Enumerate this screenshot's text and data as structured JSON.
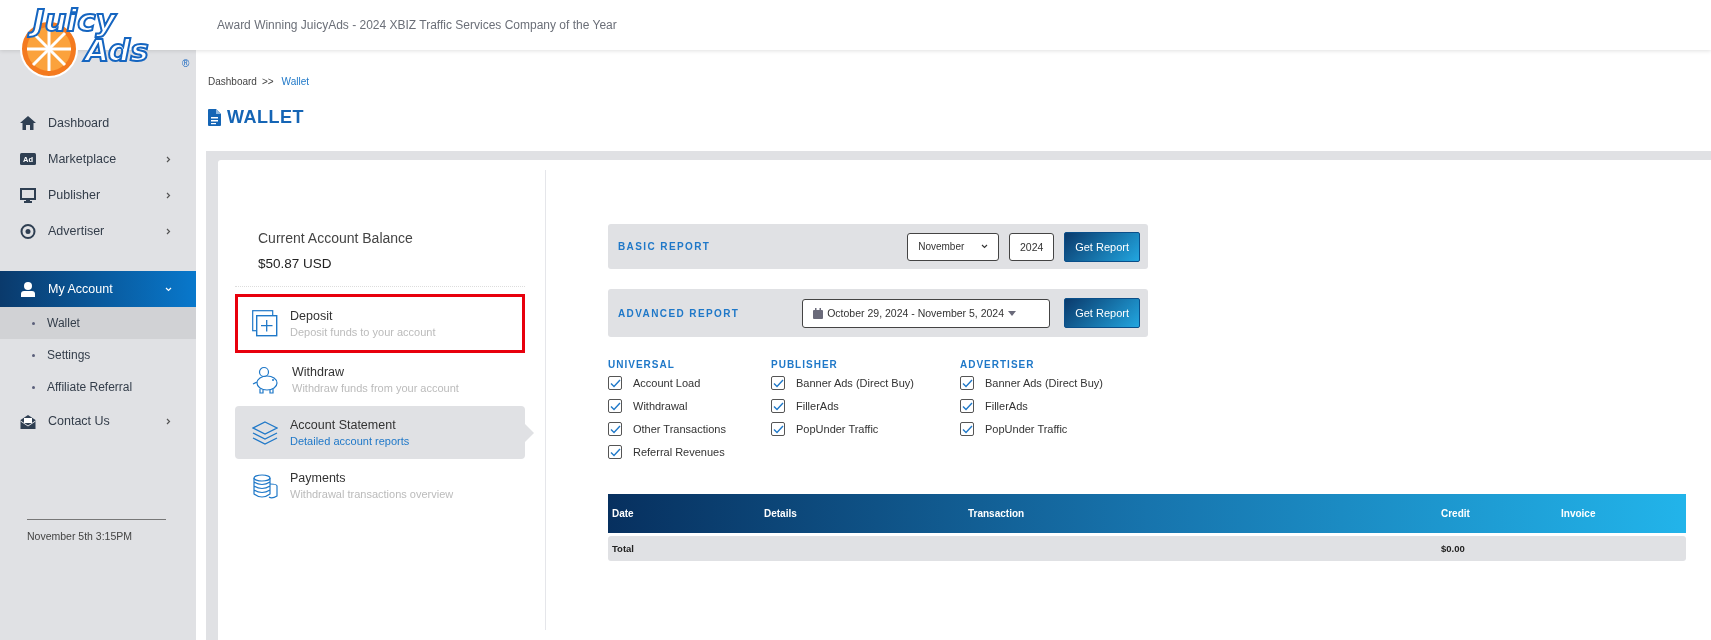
{
  "logo": {
    "line1": "Juicy",
    "line2": "Ads",
    "mark": "®"
  },
  "header": {
    "tagline": "Award Winning JuicyAds - 2024 XBIZ Traffic Services Company of the Year"
  },
  "sidebar": {
    "items": [
      {
        "kind": "home",
        "label": "Dashboard",
        "submenu": false,
        "expanded": false
      },
      {
        "kind": "ad",
        "label": "Marketplace",
        "icon_text": "Ad",
        "submenu": true,
        "expanded": false
      },
      {
        "kind": "monitor",
        "label": "Publisher",
        "submenu": true,
        "expanded": false
      },
      {
        "kind": "target",
        "label": "Advertiser",
        "submenu": true,
        "expanded": false
      },
      {
        "kind": "user",
        "label": "My Account",
        "submenu": true,
        "expanded": true,
        "children": [
          {
            "label": "Wallet",
            "selected": true
          },
          {
            "label": "Settings",
            "selected": false
          },
          {
            "label": "Affiliate Referral",
            "selected": false
          }
        ]
      },
      {
        "kind": "mail",
        "label": "Contact Us",
        "submenu": true,
        "expanded": false
      }
    ],
    "datetime": "November 5th 3:15PM"
  },
  "breadcrumb": [
    {
      "label": "Dashboard",
      "current": false
    },
    {
      "label": "Wallet",
      "current": true
    }
  ],
  "breadcrumb_separator": ">>",
  "page_title": "WALLET",
  "wallet": {
    "balance_label": "Current Account Balance",
    "balance": "$50.87 USD",
    "actions": [
      {
        "kind": "deposit",
        "title": "Deposit",
        "subtitle": "Deposit funds to your account",
        "selected": false,
        "highlighted": true
      },
      {
        "kind": "withdraw",
        "title": "Withdraw",
        "subtitle": "Withdraw funds from your account",
        "selected": false,
        "highlighted": false
      },
      {
        "kind": "statement",
        "title": "Account Statement",
        "subtitle": "Detailed account reports",
        "selected": true,
        "highlighted": false
      },
      {
        "kind": "payments",
        "title": "Payments",
        "subtitle": "Withdrawal transactions overview",
        "selected": false,
        "highlighted": false
      }
    ]
  },
  "basic_report": {
    "label": "BASIC REPORT",
    "month": "November",
    "year": "2024",
    "button": "Get Report"
  },
  "advanced_report": {
    "label": "ADVANCED REPORT",
    "date_range": "October 29, 2024 - November 5, 2024",
    "button": "Get Report"
  },
  "filters": [
    {
      "heading": "UNIVERSAL",
      "options": [
        {
          "label": "Account Load",
          "checked": true
        },
        {
          "label": "Withdrawal",
          "checked": true
        },
        {
          "label": "Other Transactions",
          "checked": true
        },
        {
          "label": "Referral Revenues",
          "checked": true
        }
      ]
    },
    {
      "heading": "PUBLISHER",
      "options": [
        {
          "label": "Banner Ads (Direct Buy)",
          "checked": true
        },
        {
          "label": "FillerAds",
          "checked": true
        },
        {
          "label": "PopUnder Traffic",
          "checked": true
        }
      ]
    },
    {
      "heading": "ADVERTISER",
      "options": [
        {
          "label": "Banner Ads (Direct Buy)",
          "checked": true
        },
        {
          "label": "FillerAds",
          "checked": true
        },
        {
          "label": "PopUnder Traffic",
          "checked": true
        }
      ]
    }
  ],
  "table": {
    "columns": [
      "Date",
      "Details",
      "Transaction",
      "Credit",
      "Invoice"
    ],
    "rows": [
      {
        "cells": [
          "Total",
          "",
          "",
          "$0.00",
          ""
        ]
      }
    ]
  }
}
